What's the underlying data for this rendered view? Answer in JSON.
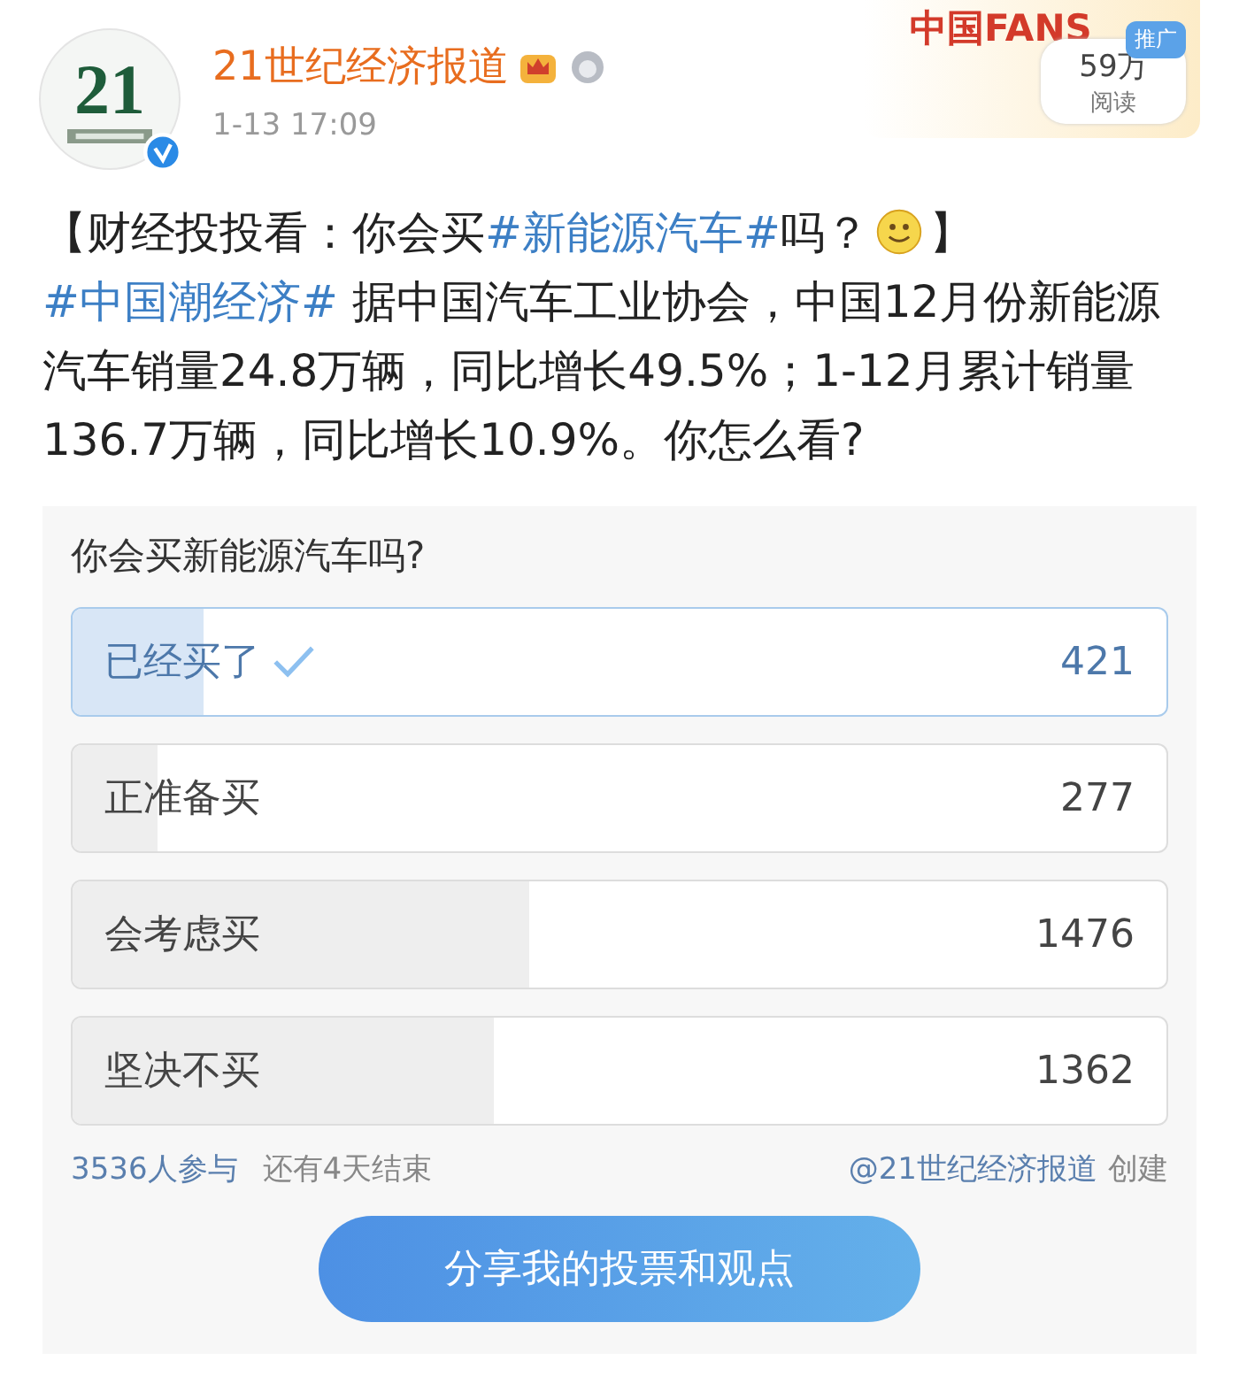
{
  "author": {
    "name": "21世纪经济报道",
    "logo_text": "21",
    "time": "1-13 17:09",
    "verified": true
  },
  "banner": {
    "text": "中国FANS",
    "reads": "59万",
    "reads_label": "阅读",
    "tag": "推广"
  },
  "post": [
    {
      "kind": "text",
      "text": "【财经投投看：你会买"
    },
    {
      "kind": "hashtag",
      "text": "#新能源汽车#"
    },
    {
      "kind": "text",
      "text": "吗？"
    },
    {
      "kind": "emoji"
    },
    {
      "kind": "text",
      "text": "】"
    },
    {
      "kind": "hashtag",
      "text": "#中国潮经济#"
    },
    {
      "kind": "text",
      "text": " 据中国汽车工业协会，中国12月份新能源汽车销量24.8万辆，同比增长49.5%；1-12月累计销量136.7万辆，同比增长10.9%。你怎么看?"
    }
  ],
  "poll": {
    "question": "你会买新能源汽车吗?",
    "options": [
      {
        "label": "已经买了",
        "count": "421",
        "level": 0.12,
        "selected": true
      },
      {
        "label": "正准备买",
        "count": "277",
        "level": 0.078,
        "selected": false
      },
      {
        "label": "会考虑买",
        "count": "1476",
        "level": 0.417,
        "selected": false
      },
      {
        "label": "坚决不买",
        "count": "1362",
        "level": 0.385,
        "selected": false
      }
    ],
    "participants": "3536人参与",
    "remaining": "还有4天结束",
    "creator": "@21世纪经济报道",
    "created": "创建",
    "share_button": "分享我的投票和观点"
  }
}
